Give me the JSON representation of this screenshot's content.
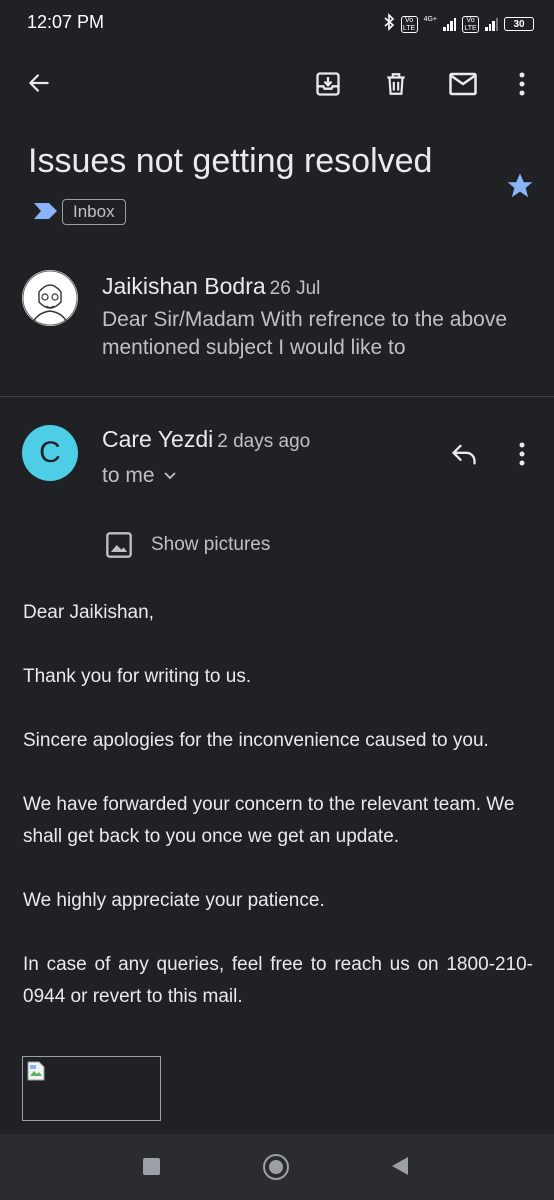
{
  "status": {
    "time": "12:07 PM",
    "sim1_label": "Vo LTE",
    "sim1_network": "4G+",
    "sim2_label": "Vo LTE",
    "battery": "30"
  },
  "toolbar": {
    "back_icon": "arrow-left-icon",
    "archive_icon": "archive-icon",
    "delete_icon": "trash-icon",
    "mark_unread_icon": "mail-icon",
    "more_icon": "more-vertical-icon"
  },
  "email": {
    "subject": "Issues not getting resolved",
    "label": "Inbox",
    "starred": true
  },
  "thread": [
    {
      "sender": "Jaikishan Bodra",
      "date": "26 Jul",
      "snippet": "Dear Sir/Madam With refrence to the above mentioned subject I would like to"
    },
    {
      "sender": "Care Yezdi",
      "avatar_letter": "C",
      "date": "2 days ago",
      "recipient": "to me",
      "show_pictures": "Show pictures",
      "body": [
        "Dear Jaikishan,",
        "Thank you for writing to us.",
        "Sincere apologies for the inconvenience caused to you.",
        "We have forwarded your concern to the relevant team. We shall get back to you once we get an update.",
        "We highly appreciate your patience.",
        "In case of any queries, feel free to reach us on 1800-210-0944 or revert to this mail."
      ]
    }
  ],
  "colors": {
    "background": "#202124",
    "star": "#8ab4f8",
    "avatar_c": "#4ecde6",
    "important_marker": "#8ab4f8"
  }
}
